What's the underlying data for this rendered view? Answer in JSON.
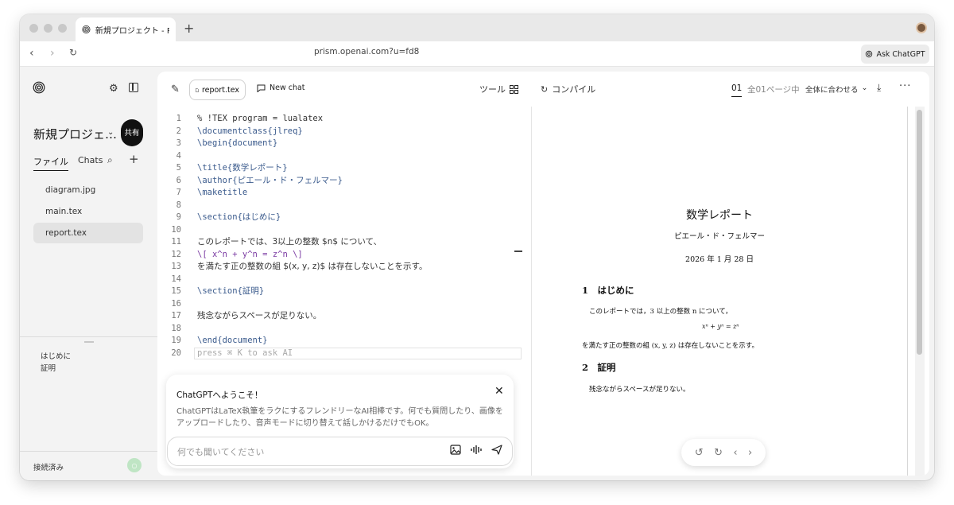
{
  "browser": {
    "tab_title": "新規プロジェクト - Pri",
    "url": "prism.openai.com?u=fd8",
    "ask_chatgpt": "Ask ChatGPT",
    "new_tab": "+"
  },
  "sidebar": {
    "project_title": "新規プロジェ…",
    "share_label": "共有",
    "tabs": [
      "ファイル",
      "Chats"
    ],
    "files": [
      "diagram.jpg",
      "main.tex",
      "report.tex"
    ],
    "active_file": "report.tex",
    "outline": [
      "はじめに",
      "証明"
    ],
    "status": "接続済み",
    "status_badge": "○"
  },
  "toolbar": {
    "file_tab": "report.tex",
    "new_chat": "New chat",
    "tools": "ツール",
    "compile": "コンパイル",
    "page_current": "01",
    "page_total": "全01ページ中",
    "fit": "全体に合わせる"
  },
  "editor": {
    "lines": [
      {
        "n": "1",
        "text": "% !TEX program = lualatex"
      },
      {
        "n": "2",
        "text": "\\documentclass{jlreq}"
      },
      {
        "n": "3",
        "text": "\\begin{document}"
      },
      {
        "n": "4",
        "text": ""
      },
      {
        "n": "5",
        "text": "\\title{数学レポート}"
      },
      {
        "n": "6",
        "text": "\\author{ピエール・ド・フェルマー}"
      },
      {
        "n": "7",
        "text": "\\maketitle"
      },
      {
        "n": "8",
        "text": ""
      },
      {
        "n": "9",
        "text": "\\section{はじめに}"
      },
      {
        "n": "10",
        "text": ""
      },
      {
        "n": "11",
        "text": "このレポートでは、3以上の整数 $n$ について、"
      },
      {
        "n": "12",
        "text": "\\[ x^n + y^n = z^n \\]"
      },
      {
        "n": "13",
        "text": "を満たす正の整数の組 $(x, y, z)$ は存在しないことを示す。"
      },
      {
        "n": "14",
        "text": ""
      },
      {
        "n": "15",
        "text": "\\section{証明}"
      },
      {
        "n": "16",
        "text": ""
      },
      {
        "n": "17",
        "text": "残念ながらスペースが足りない。"
      },
      {
        "n": "18",
        "text": ""
      },
      {
        "n": "19",
        "text": "\\end{document}"
      },
      {
        "n": "20",
        "text": "press ⌘ K to ask AI"
      }
    ]
  },
  "chat": {
    "title": "ChatGPTへようこそ！",
    "description": "ChatGPTはLaTeX執筆をラクにするフレンドリーなAI相棒です。何でも質問したり、画像をアップロードしたり、音声モードに切り替えて話しかけるだけでもOK。",
    "placeholder": "何でも聞いてください",
    "close": "✕"
  },
  "preview": {
    "title": "数学レポート",
    "author": "ピエール・ド・フェルマー",
    "date": "2026 年 1 月 28 日",
    "section1": "1　はじめに",
    "para1": "このレポートでは，3 以上の整数 n について，",
    "equation": "xⁿ + yⁿ = zⁿ",
    "para2": "を満たす正の整数の組 (x, y, z) は存在しないことを示す。",
    "section2": "2　証明",
    "para3": "残念ながらスペースが足りない。"
  }
}
